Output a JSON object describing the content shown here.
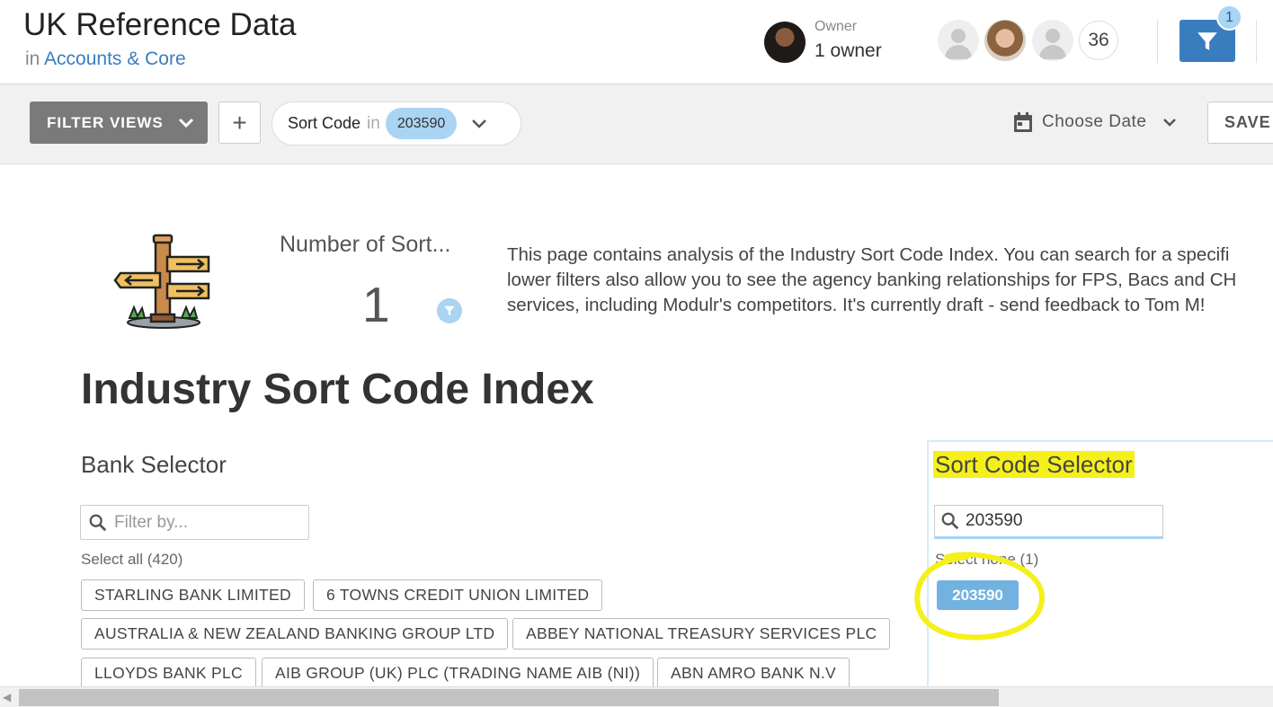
{
  "header": {
    "title": "UK Reference Data",
    "in_label": "in",
    "space_link": "Accounts & Core",
    "owner_label": "Owner",
    "owner_count": "1 owner",
    "viewer_count": "36",
    "filter_badge_count": "1"
  },
  "filterbar": {
    "filter_views_label": "FILTER VIEWS",
    "add_label": "+",
    "pill_field": "Sort Code",
    "pill_operator": "in",
    "pill_value": "203590",
    "date_label": "Choose Date",
    "save_label": "SAVE I"
  },
  "kpi": {
    "title": "Number of Sort...",
    "value": "1"
  },
  "description": {
    "line1": "This page contains analysis of the Industry Sort Code Index. You can search for a specifi",
    "line2": "lower filters also allow you to see the agency banking relationships for FPS, Bacs and CH",
    "line3": "services, including Modulr's competitors. It's currently draft - send feedback to Tom M!"
  },
  "page_heading": "Industry Sort Code Index",
  "bank_selector": {
    "title": "Bank Selector",
    "placeholder": "Filter by...",
    "select_all": "Select all (420)",
    "banks": [
      "STARLING BANK LIMITED",
      "6 TOWNS CREDIT UNION LIMITED",
      "AUSTRALIA & NEW ZEALAND BANKING GROUP LTD",
      "ABBEY NATIONAL TREASURY SERVICES PLC",
      "LLOYDS BANK PLC",
      "AIB GROUP (UK) PLC (TRADING NAME AIB (NI))",
      "ABN AMRO BANK N.V"
    ]
  },
  "sort_code_selector": {
    "title": "Sort Code Selector",
    "search_value": "203590",
    "select_none": "Select none (1)",
    "selected_chip": "203590"
  },
  "colors": {
    "accent_blue": "#3a7dbf",
    "chip_blue": "#a9d4f2",
    "selected_chip": "#71b2e0",
    "highlight_yellow": "#f5f01a"
  }
}
